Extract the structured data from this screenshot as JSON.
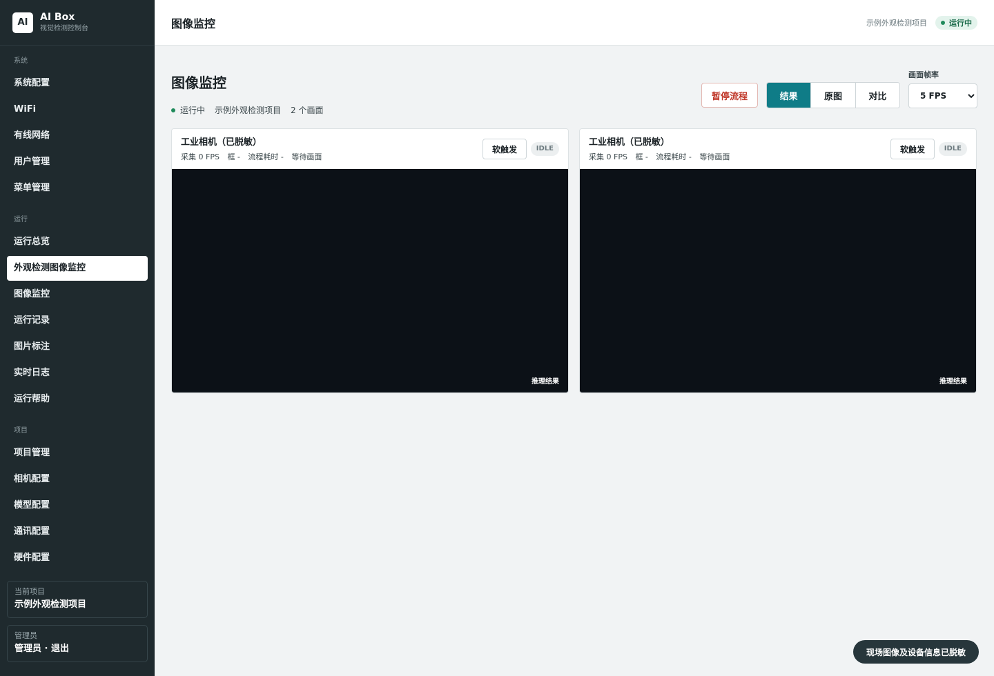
{
  "brand": {
    "logo": "AI",
    "title": "AI Box",
    "subtitle": "视觉检测控制台"
  },
  "sidebar": {
    "groups": [
      {
        "label": "系统",
        "items": [
          "系统配置",
          "WiFi",
          "有线网络",
          "用户管理",
          "菜单管理"
        ]
      },
      {
        "label": "运行",
        "items": [
          "运行总览",
          "外观检测图像监控",
          "图像监控",
          "运行记录",
          "图片标注",
          "实时日志",
          "运行帮助"
        ]
      },
      {
        "label": "项目",
        "items": [
          "项目管理",
          "相机配置",
          "模型配置",
          "通讯配置",
          "硬件配置"
        ]
      }
    ],
    "active_item": "外观检测图像监控",
    "current_project": {
      "label": "当前项目",
      "value": "示例外观检测项目"
    },
    "admin": {
      "label": "管理员",
      "value": "管理员 · 退出"
    }
  },
  "topbar": {
    "title": "图像监控",
    "project": "示例外观检测项目",
    "status": "运行中"
  },
  "main": {
    "title": "图像监控",
    "meta": {
      "status": "运行中",
      "project": "示例外观检测项目",
      "count": "2 个画面"
    },
    "pause_label": "暂停流程",
    "view_tabs": [
      "结果",
      "原图",
      "对比"
    ],
    "active_tab": "结果",
    "fps": {
      "label": "画面帧率",
      "value": "5 FPS"
    }
  },
  "cameras": [
    {
      "title": "工业相机（已脱敏）",
      "stats": {
        "capture": "采集 0 FPS",
        "box": "框 -",
        "cost": "流程耗时 -",
        "state": "等待画面"
      },
      "trigger_label": "软触发",
      "badge": "IDLE",
      "view_label": "推理结果"
    },
    {
      "title": "工业相机（已脱敏）",
      "stats": {
        "capture": "采集 0 FPS",
        "box": "框 -",
        "cost": "流程耗时 -",
        "state": "等待画面"
      },
      "trigger_label": "软触发",
      "badge": "IDLE",
      "view_label": "推理结果"
    }
  ],
  "toast": "现场图像及设备信息已脱敏",
  "colors": {
    "sidebar_bg": "#1f2a2e",
    "accent": "#0f7c87",
    "danger": "#c0392b",
    "status_green": "#1f8a5b",
    "video_bg": "#0c1117"
  }
}
